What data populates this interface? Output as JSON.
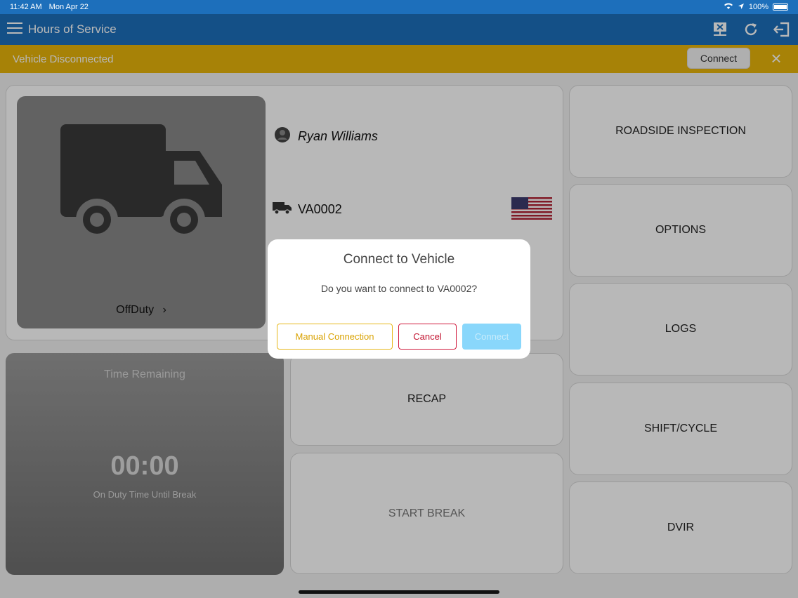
{
  "status_bar": {
    "time": "11:42 AM",
    "date": "Mon Apr 22",
    "battery": "100%"
  },
  "nav": {
    "title": "Hours of Service",
    "icons": [
      "menu-icon",
      "network-disconnected-icon",
      "refresh-icon",
      "logout-icon"
    ]
  },
  "alert": {
    "text": "Vehicle Disconnected",
    "connect_label": "Connect",
    "close_icon": "close-icon"
  },
  "driver": {
    "name": "Ryan Williams",
    "vehicle_id": "VA0002",
    "duty_status": "OffDuty",
    "country_flag": "US"
  },
  "time_card": {
    "label": "Time Remaining",
    "value": "00:00",
    "sub": "On Duty Time Until Break"
  },
  "tiles": {
    "recap": "RECAP",
    "start_break": "START BREAK",
    "roadside_inspection": "ROADSIDE INSPECTION",
    "options": "OPTIONS",
    "logs": "LOGS",
    "shift_cycle": "SHIFT/CYCLE",
    "dvir": "DVIR"
  },
  "dialog": {
    "title": "Connect to Vehicle",
    "message": "Do you want to connect to VA0002?",
    "manual_label": "Manual Connection",
    "cancel_label": "Cancel",
    "connect_label": "Connect"
  },
  "colors": {
    "nav": "#1d6fbb",
    "alert": "#e8b40a",
    "manual": "#e7b81a",
    "cancel": "#d01a3d",
    "connect": "#89d7fb"
  }
}
